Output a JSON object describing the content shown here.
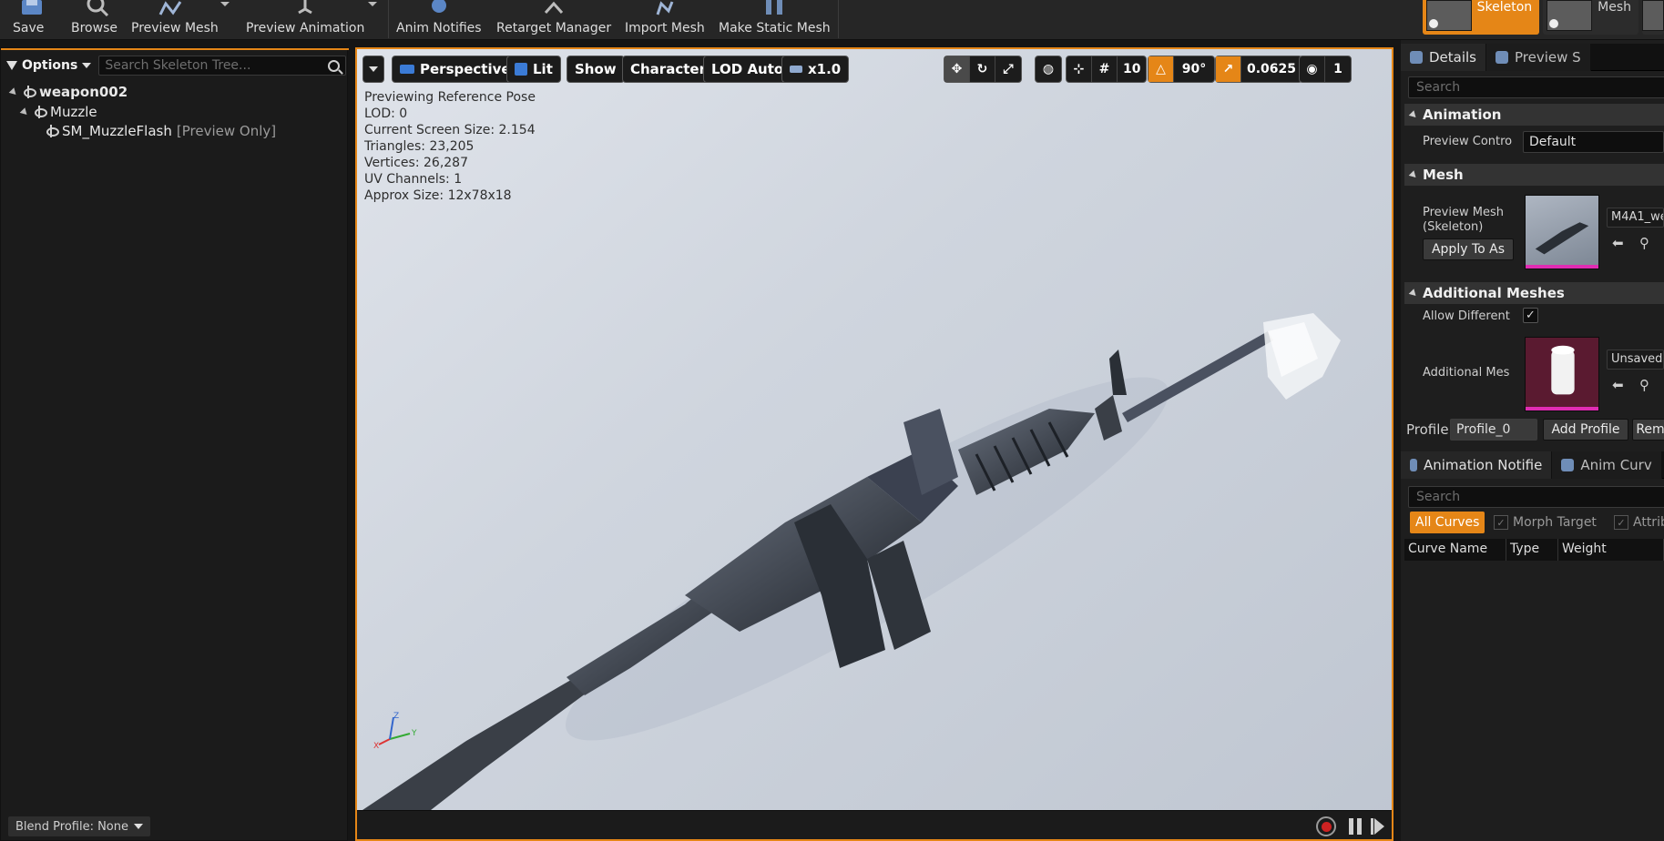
{
  "toolbar": {
    "items": [
      {
        "label": "Save",
        "icon": "save-icon"
      },
      {
        "label": "Browse",
        "icon": "browse-icon"
      },
      {
        "label": "Preview Mesh",
        "icon": "preview-mesh-icon"
      },
      {
        "label": "Preview Animation",
        "icon": "preview-animation-icon"
      },
      {
        "label": "Anim Notifies",
        "icon": "anim-notifies-icon"
      },
      {
        "label": "Retarget Manager",
        "icon": "retarget-manager-icon"
      },
      {
        "label": "Import Mesh",
        "icon": "import-mesh-icon"
      },
      {
        "label": "Make Static Mesh",
        "icon": "make-static-mesh-icon"
      }
    ],
    "modes": [
      {
        "label": "Skeleton",
        "active": true
      },
      {
        "label": "Mesh",
        "active": false
      }
    ]
  },
  "skeleton_tree": {
    "options_label": "Options",
    "search_placeholder": "Search Skeleton Tree...",
    "nodes": [
      {
        "label": "weapon002",
        "suffix": ""
      },
      {
        "label": "Muzzle",
        "suffix": ""
      },
      {
        "label": "SM_MuzzleFlash",
        "suffix": "[Preview Only]"
      }
    ],
    "blend_profile": "Blend Profile: None"
  },
  "viewport": {
    "buttons": {
      "perspective": "Perspective",
      "lit": "Lit",
      "show": "Show",
      "character": "Character",
      "lod": "LOD Auto",
      "speed": "x1.0"
    },
    "grid_snap": "10",
    "rot_snap": "90°",
    "scale_snap": "0.0625",
    "camera_speed": "1",
    "stats": [
      "Previewing Reference Pose",
      "LOD: 0",
      "Current Screen Size: 2.154",
      "Triangles: 23,205",
      "Vertices: 26,287",
      "UV Channels: 1",
      "Approx Size: 12x78x18"
    ],
    "axes": {
      "x": "X",
      "y": "Y",
      "z": "Z"
    }
  },
  "details": {
    "tabs": [
      {
        "label": "Details"
      },
      {
        "label": "Preview S"
      }
    ],
    "search_placeholder": "Search",
    "animation": {
      "header": "Animation",
      "preview_controller_label": "Preview Contro",
      "preview_controller_value": "Default"
    },
    "mesh": {
      "header": "Mesh",
      "preview_mesh_label": "Preview Mesh (Skeleton)",
      "apply_button": "Apply To As",
      "asset_name": "M4A1_we"
    },
    "additional_meshes": {
      "header": "Additional Meshes",
      "allow_different_label": "Allow Different",
      "allow_different_checked": "✓",
      "additional_mesh_label": "Additional Mes",
      "asset_name": "Unsaved"
    },
    "profile": {
      "label": "Profile",
      "value": "Profile_0",
      "add_button": "Add Profile",
      "remove_button": "Rem"
    }
  },
  "curves_panel": {
    "tabs": [
      {
        "label": "Animation Notifie"
      },
      {
        "label": "Anim Curv"
      }
    ],
    "search_placeholder": "Search",
    "filters": [
      {
        "label": "All Curves",
        "active": true
      },
      {
        "label": "Morph Target",
        "active": false
      },
      {
        "label": "Attrib",
        "active": false
      }
    ],
    "columns": [
      "Curve Name",
      "Type",
      "Weight"
    ]
  },
  "colors": {
    "accent": "#e58617",
    "panel_bg": "#1b1b1b",
    "viewport_bg": "#d3d9e1",
    "asset_strip": "#e02cb3"
  }
}
